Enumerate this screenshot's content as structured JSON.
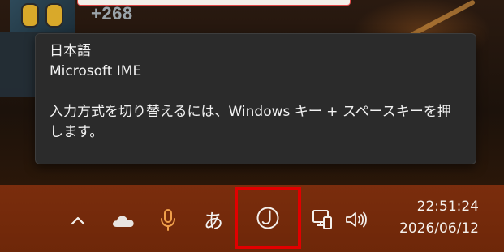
{
  "background": {
    "badge_count": "+268"
  },
  "tooltip": {
    "language": "日本語",
    "ime_name": "Microsoft IME",
    "hint_line1": "入力方式を切り替えるには、Windows キー + スペースキーを押",
    "hint_line2": "します。"
  },
  "taskbar": {
    "ime_mode_label": "あ",
    "time": "22:51:24",
    "date": "2026/06/12",
    "icons": {
      "show_hidden": "chevron-up-icon",
      "onedrive": "cloud-icon",
      "microphone": "microphone-icon",
      "ime_pad": "ime-pad-icon",
      "network": "network-icon",
      "volume": "speaker-icon"
    },
    "colors": {
      "taskbar_bg": "#7a2d0d",
      "mic_accent": "#f0a04b",
      "highlight_border": "#e20000"
    }
  }
}
